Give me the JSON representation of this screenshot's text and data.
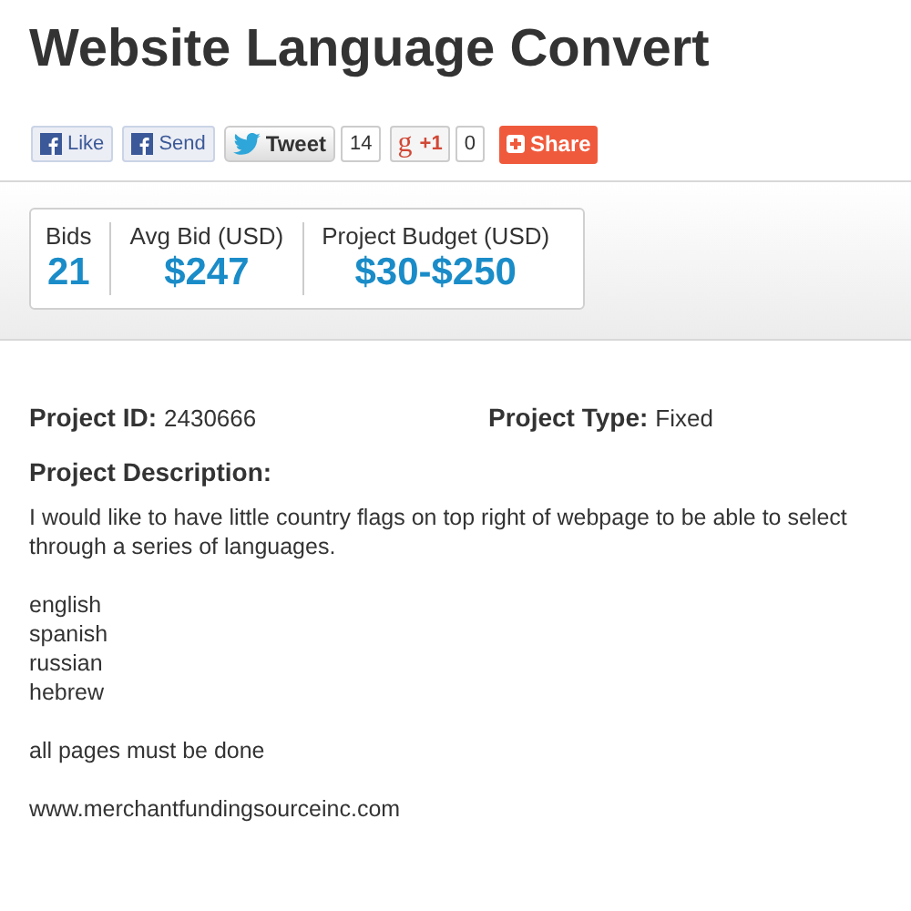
{
  "title": "Website Language Convert",
  "social": [
    {
      "kind": "facebook",
      "label": "Like"
    },
    {
      "kind": "facebook",
      "label": "Send"
    },
    {
      "kind": "twitter",
      "label": "Tweet",
      "count": "14"
    },
    {
      "kind": "google",
      "icon": "g",
      "label": "+1",
      "count": "0"
    },
    {
      "kind": "share",
      "label": "Share"
    }
  ],
  "stats": [
    {
      "label": "Bids",
      "value": "21"
    },
    {
      "label": "Avg Bid (USD)",
      "value": "$247"
    },
    {
      "label": "Project Budget (USD)",
      "value": "$30-$250"
    }
  ],
  "details": [
    {
      "label": "Project ID:",
      "value": "2430666"
    },
    {
      "label": "Project Type:",
      "value": "Fixed"
    }
  ],
  "description": {
    "heading": "Project Description:",
    "paragraphs": [
      [
        "I would like to have little country flags on top right of webpage to be able to select through a series of languages."
      ],
      [
        "english",
        "spanish",
        "russian",
        "hebrew"
      ],
      [
        "all pages must be done"
      ],
      [
        "www.merchantfundingsourceinc.com"
      ]
    ]
  }
}
